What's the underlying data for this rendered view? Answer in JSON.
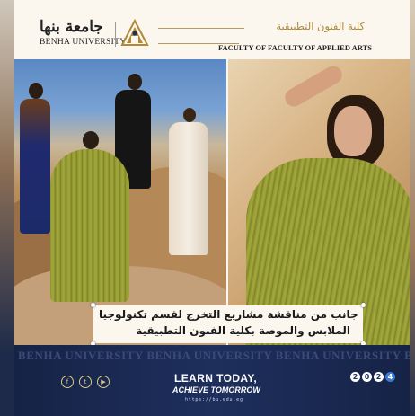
{
  "header": {
    "university_ar": "جامعة بنها",
    "university_en": "BENHA UNIVERSITY",
    "faculty_ar": "كلية الفنون التطبيقية",
    "faculty_en": "FACULTY OF FACULTY OF APPLIED ARTS"
  },
  "caption": {
    "line1": "جانب من مناقشة مشاريع التخرج لقسم تكنولوجيا",
    "line2": "الملابس والموضة بكلية الفنون التطبيقية"
  },
  "footer": {
    "watermark": "BENHA UNIVERSITY BENHA UNIVERSITY BENHA UNIVERSITY BENHA UNIVERSITY",
    "slogan_line1": "LEARN TODAY,",
    "slogan_line2": "ACHIEVE TOMORROW",
    "url": "https://bu.edu.eg",
    "year_digits": [
      "2",
      "0",
      "2",
      "4"
    ],
    "social_icons": [
      "facebook-icon",
      "twitter-icon",
      "youtube-icon"
    ]
  },
  "colors": {
    "gold": "#b0893a",
    "navy": "#1e2f5d",
    "cream": "#fbf7ef",
    "olive": "#8c8f2c"
  }
}
